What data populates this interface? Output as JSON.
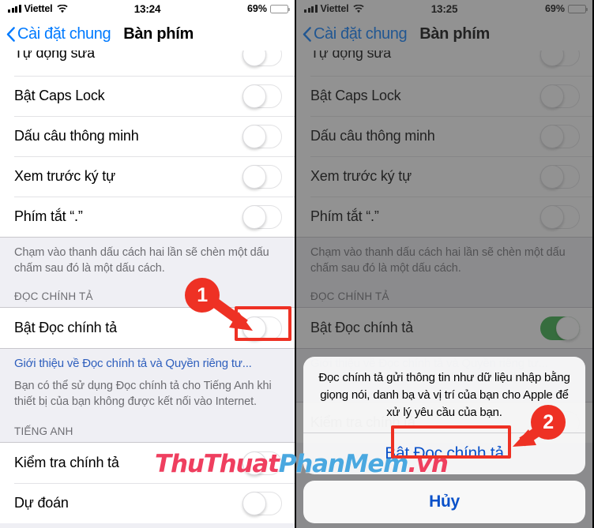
{
  "meta": {
    "accent_blue": "#007aff",
    "link_blue": "#2f5fbd",
    "alert_blue": "#0a51c9",
    "toggle_green": "#2fab40",
    "annotation_red": "#ee3124",
    "battery_yellow": "#ffd400"
  },
  "watermark": {
    "part1": "ThuThuat",
    "part2": "PhanMem",
    "part3": ".vn"
  },
  "left_phone": {
    "status_bar": {
      "carrier": "Viettel",
      "time": "13:24",
      "battery_percent": "69%",
      "battery_level": 69,
      "signal_icon": "signal-bars-icon",
      "wifi_icon": "wifi-icon",
      "battery_icon": "battery-icon"
    },
    "nav": {
      "back_label": "Cài đặt chung",
      "back_icon": "chevron-left-icon",
      "title": "Bàn phím"
    },
    "rows_top": [
      {
        "label": "Tự động sửa",
        "toggle": "off",
        "partial": true
      },
      {
        "label": "Bật Caps Lock",
        "toggle": "off",
        "partial": false
      },
      {
        "label": "Dấu câu thông minh",
        "toggle": "off",
        "partial": false
      },
      {
        "label": "Xem trước ký tự",
        "toggle": "off",
        "partial": false
      },
      {
        "label": "Phím tắt “.”",
        "toggle": "off",
        "partial": false
      }
    ],
    "footer_text": "Chạm vào thanh dấu cách hai lần sẽ chèn một dấu chấm sau đó là một dấu cách.",
    "dictation_header": "ĐỌC CHÍNH TẢ",
    "dictation_row": {
      "label": "Bật Đọc chính tả",
      "toggle": "off"
    },
    "link_text": "Giới thiệu về Đọc chính tả và Quyền riêng tư...",
    "note_text": "Bạn có thể sử dụng Đọc chính tả cho Tiếng Anh khi thiết bị của bạn không được kết nối vào Internet.",
    "english_header": "TIẾNG ANH",
    "rows_bottom": [
      {
        "label": "Kiểm tra chính tả",
        "toggle": "off"
      },
      {
        "label": "Dự đoán",
        "toggle": "off"
      }
    ]
  },
  "right_phone": {
    "status_bar": {
      "carrier": "Viettel",
      "time": "13:25",
      "battery_percent": "69%",
      "battery_level": 69,
      "signal_icon": "signal-bars-icon",
      "wifi_icon": "wifi-icon",
      "battery_icon": "battery-icon"
    },
    "nav": {
      "back_label": "Cài đặt chung",
      "back_icon": "chevron-left-icon",
      "title": "Bàn phím"
    },
    "rows_top": [
      {
        "label": "Tự động sửa",
        "toggle": "off",
        "partial": true
      },
      {
        "label": "Bật Caps Lock",
        "toggle": "off",
        "partial": false
      },
      {
        "label": "Dấu câu thông minh",
        "toggle": "off",
        "partial": false
      },
      {
        "label": "Xem trước ký tự",
        "toggle": "off",
        "partial": false
      },
      {
        "label": "Phím tắt “.”",
        "toggle": "off",
        "partial": false
      }
    ],
    "footer_text": "Chạm vào thanh dấu cách hai lần sẽ chèn một dấu chấm sau đó là một dấu cách.",
    "dictation_header": "ĐỌC CHÍNH TẢ",
    "dictation_row": {
      "label": "Bật Đọc chính tả",
      "toggle": "on"
    },
    "link_text": "Giới thiệu về Đọc chính tả và Quyền riêng tư...",
    "rows_bottom": [
      {
        "label": "Kiểm tra chính tả",
        "toggle": "off"
      }
    ],
    "alert": {
      "message": "Đọc chính tả gửi thông tin như dữ liệu nhập bằng giọng nói, danh bạ và vị trí của bạn cho Apple để xử lý yêu cầu của bạn.",
      "confirm_label": "Bật Đọc chính tả",
      "cancel_label": "Hủy"
    }
  },
  "annotations": [
    {
      "number": "1",
      "target": "dictation-toggle-left"
    },
    {
      "number": "2",
      "target": "alert-confirm-button-right"
    }
  ]
}
